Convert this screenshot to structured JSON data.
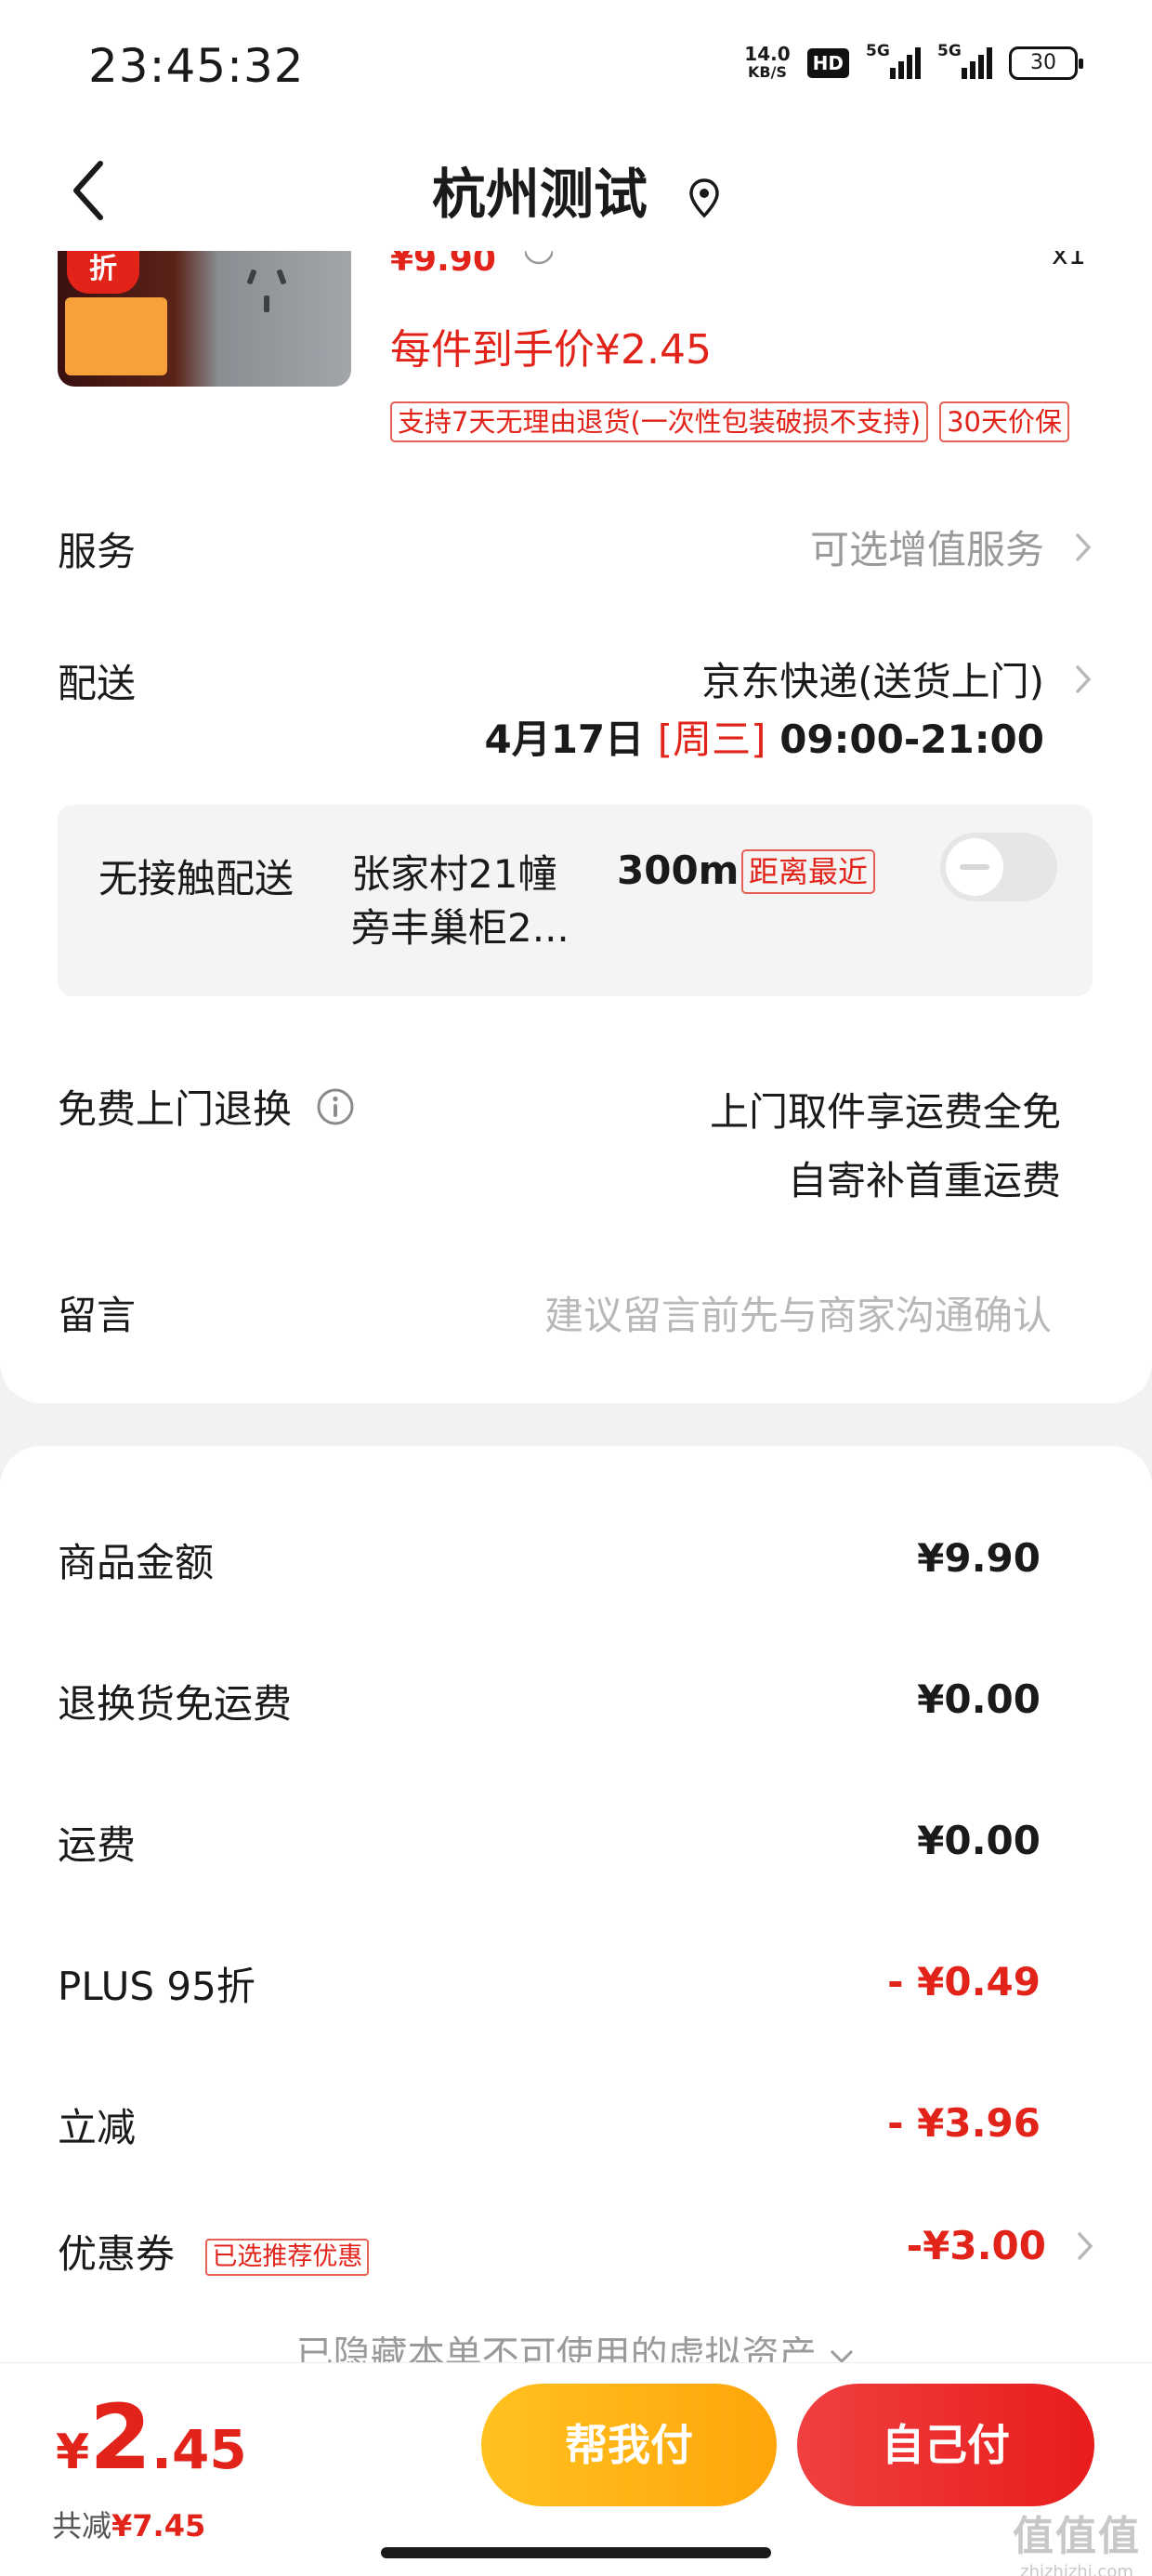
{
  "status_bar": {
    "time": "23:45:32",
    "net_speed_value": "14.0",
    "net_speed_unit": "KB/S",
    "hd_label": "HD",
    "signal1_label": "5G",
    "signal2_label": "5G",
    "battery": "30"
  },
  "header": {
    "title": "杭州测试",
    "back_icon": "chevron-left-icon",
    "location_icon": "location-pin-icon"
  },
  "product": {
    "badge": "折",
    "price_partial": "¥9.90",
    "qty_partial": "x1",
    "each_price": "每件到手价¥2.45",
    "tags": [
      "支持7天无理由退货(一次性包装破损不支持)",
      "30天价保"
    ]
  },
  "service": {
    "label": "服务",
    "value": "可选增值服务"
  },
  "delivery": {
    "label": "配送",
    "method": "京东快递(送货上门)",
    "date": "4月17日",
    "weekday": "[周三]",
    "time_range": "09:00-21:00"
  },
  "contactless": {
    "label": "无接触配送",
    "location_line1": "张家村21幢",
    "location_line2": "旁丰巢柜2...",
    "distance": "300m",
    "near_tag": "距离最近",
    "enabled": false
  },
  "free_return": {
    "label": "免费上门退换",
    "line1": "上门取件享运费全免",
    "line2": "自寄补首重运费"
  },
  "message": {
    "label": "留言",
    "placeholder": "建议留言前先与商家沟通确认"
  },
  "fees": {
    "goods_label": "商品金额",
    "goods_value": "¥9.90",
    "return_label": "退换货免运费",
    "return_value": "¥0.00",
    "shipping_label": "运费",
    "shipping_value": "¥0.00",
    "plus_label": "PLUS 95折",
    "plus_value": "- ¥0.49",
    "instant_label": "立减",
    "instant_value": "- ¥3.96",
    "coupon_label": "优惠券",
    "coupon_tag": "已选推荐优惠",
    "coupon_value": "-¥3.00",
    "hidden_assets": "已隐藏本单不可使用的虚拟资产"
  },
  "bottom": {
    "currency": "¥",
    "total_int": "2",
    "total_dec": ".45",
    "saved_label": "共减",
    "saved_value": "¥7.45",
    "help_pay": "帮我付",
    "self_pay": "自己付"
  },
  "watermark": {
    "line1": "值值值",
    "line2": "zhizhizhi.com"
  },
  "colors": {
    "accent_red": "#e2231a",
    "help_button": "#ffb414",
    "pay_button": "#ea2626"
  }
}
